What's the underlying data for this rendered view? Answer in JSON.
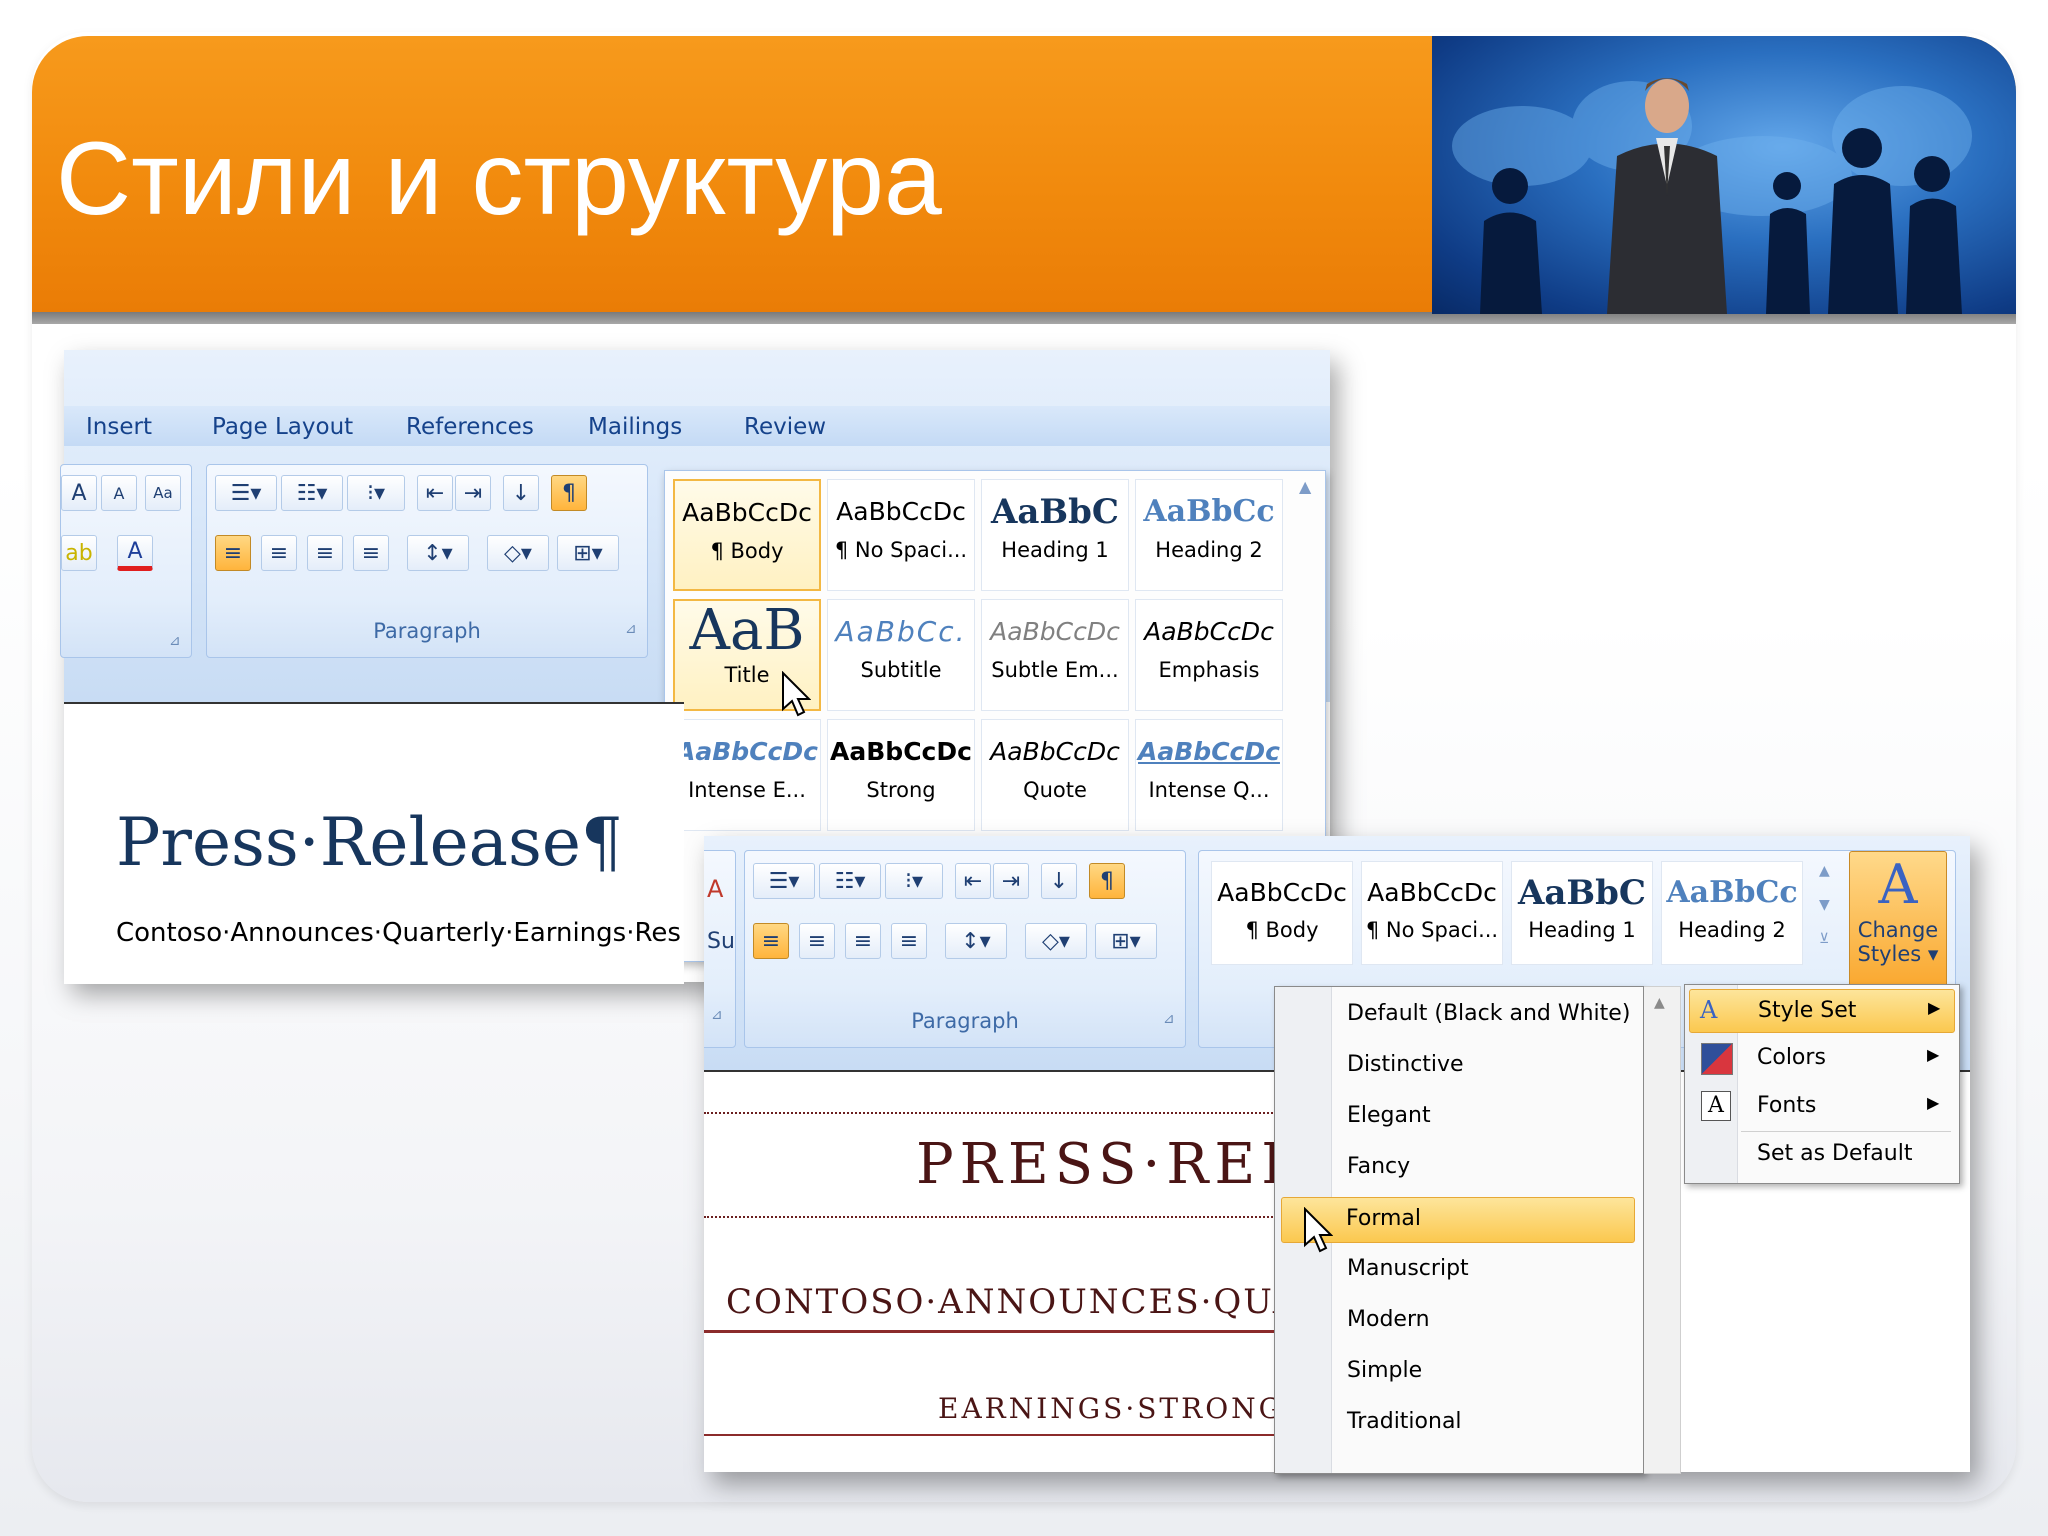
{
  "slide": {
    "title": "Стили и структура",
    "colors": {
      "banner": "#f18a0d",
      "ribbon": "#c4daf5",
      "text_blue": "#15428b",
      "doc_red": "#6b1f1f"
    }
  },
  "window1": {
    "tabs": [
      "Insert",
      "Page Layout",
      "References",
      "Mailings",
      "Review"
    ],
    "paragraph_group_label": "Paragraph",
    "styles": [
      {
        "preview": "AaBbCcDc",
        "name": "¶ Body"
      },
      {
        "preview": "AaBbCcDc",
        "name": "¶ No Spaci..."
      },
      {
        "preview": "AaBbC",
        "name": "Heading 1"
      },
      {
        "preview": "AaBbCc",
        "name": "Heading 2"
      },
      {
        "preview": "AaB",
        "name": "Title"
      },
      {
        "preview": "AaBbCc.",
        "name": "Subtitle"
      },
      {
        "preview": "AaBbCcDc",
        "name": "Subtle Em..."
      },
      {
        "preview": "AaBbCcDc",
        "name": "Emphasis"
      },
      {
        "preview": "AaBbCcDc",
        "name": "Intense E..."
      },
      {
        "preview": "AaBbCcDc",
        "name": "Strong"
      },
      {
        "preview": "AaBbCcDc",
        "name": "Quote"
      },
      {
        "preview": "AaBbCcDc",
        "name": "Intense Q..."
      }
    ],
    "selected_style": "Title",
    "doc": {
      "heading": "Press·Release¶",
      "subline": "Contoso·Announces·Quarterly·Earnings·Res"
    }
  },
  "window2": {
    "paragraph_group_label": "Paragraph",
    "styles": [
      {
        "preview": "AaBbCcDc",
        "name": "¶ Body"
      },
      {
        "preview": "AaBbCcDc",
        "name": "¶ No Spaci..."
      },
      {
        "preview": "AaBbC",
        "name": "Heading 1"
      },
      {
        "preview": "AaBbCc",
        "name": "Heading 2"
      }
    ],
    "change_styles": {
      "line1": "Change",
      "line2": "Styles"
    },
    "doc": {
      "heading": "PRESS·REL",
      "subhead": "CONTOSO·ANNOUNCES·QUA",
      "line3": "EARNINGS·STRONGE"
    },
    "left_clip": {
      "s1": "A",
      "s2": "Su"
    }
  },
  "style_set_menu": {
    "items": [
      "Default (Black and White)",
      "Distinctive",
      "Elegant",
      "Fancy",
      "Formal",
      "Manuscript",
      "Modern",
      "Simple",
      "Traditional"
    ],
    "highlighted": "Formal"
  },
  "change_styles_menu": {
    "items": [
      {
        "label": "Style Set",
        "submenu": true
      },
      {
        "label": "Colors",
        "submenu": true
      },
      {
        "label": "Fonts",
        "submenu": true
      },
      {
        "label": "Set as Default",
        "submenu": false
      }
    ],
    "highlighted": "Style Set"
  }
}
